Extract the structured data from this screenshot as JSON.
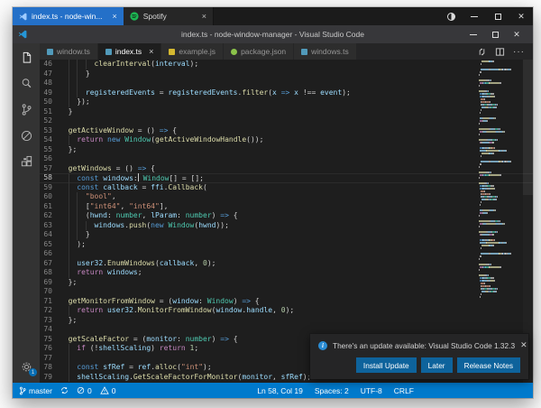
{
  "colors": {
    "accent_blue": "#007acc",
    "set_tab_active": "#2470c8",
    "btn_blue": "#0e639c",
    "ts_icon": "#519aba",
    "js_icon": "#d4b830",
    "json_icon": "#8bc34a",
    "spotify_green": "#1db954",
    "tok_kw": "#569cd6",
    "tok_ctrl": "#c586c0",
    "tok_fn": "#dcdcaa",
    "tok_type": "#4ec9b0",
    "tok_var": "#9cdcfe",
    "tok_str": "#ce9178",
    "tok_num": "#b5cea8",
    "tok_plain": "#d4d4d4"
  },
  "sets_bar": {
    "active_tab": {
      "label": "index.ts - node-win...",
      "close": "×"
    },
    "spotify_tab": {
      "label": "Spotify",
      "close": "×"
    }
  },
  "title_bar": {
    "title": "index.ts - node-window-manager - Visual Studio Code",
    "minimize": "",
    "maximize": "",
    "close": "✕"
  },
  "activity_bar": {
    "settings_badge": "1"
  },
  "editor": {
    "tabs": [
      {
        "label": "window.ts",
        "icon": "ts",
        "active": false
      },
      {
        "label": "index.ts",
        "icon": "ts",
        "active": true,
        "close": "×"
      },
      {
        "label": "example.js",
        "icon": "js",
        "active": false
      },
      {
        "label": "package.json",
        "icon": "json",
        "active": false
      },
      {
        "label": "windows.ts",
        "icon": "ts",
        "active": false
      }
    ],
    "actions": [
      "open-changes",
      "split-editor",
      "more-actions"
    ]
  },
  "code": {
    "lines": [
      {
        "n": 46,
        "s": [
          [
            "ws",
            "        "
          ],
          [
            "fn",
            "clearInterval"
          ],
          [
            "pl",
            "("
          ],
          [
            "vr",
            "interval"
          ],
          [
            "pl",
            ");"
          ]
        ]
      },
      {
        "n": 47,
        "s": [
          [
            "ws",
            "      "
          ],
          [
            "pl",
            "}"
          ]
        ]
      },
      {
        "n": 48,
        "s": []
      },
      {
        "n": 49,
        "s": [
          [
            "ws",
            "      "
          ],
          [
            "vr",
            "registeredEvents"
          ],
          [
            "pl",
            " = "
          ],
          [
            "vr",
            "registeredEvents"
          ],
          [
            "pl",
            "."
          ],
          [
            "fn",
            "filter"
          ],
          [
            "pl",
            "("
          ],
          [
            "vr",
            "x"
          ],
          [
            "pl",
            " "
          ],
          [
            "kw",
            "=>"
          ],
          [
            "pl",
            " "
          ],
          [
            "vr",
            "x"
          ],
          [
            "pl",
            " !== "
          ],
          [
            "vr",
            "event"
          ],
          [
            "pl",
            ");"
          ]
        ]
      },
      {
        "n": 50,
        "s": [
          [
            "ws",
            "    "
          ],
          [
            "pl",
            "});"
          ]
        ]
      },
      {
        "n": 51,
        "s": [
          [
            "ws",
            "  "
          ],
          [
            "pl",
            "}"
          ]
        ]
      },
      {
        "n": 52,
        "s": []
      },
      {
        "n": 53,
        "s": [
          [
            "ws",
            "  "
          ],
          [
            "fn",
            "getActiveWindow"
          ],
          [
            "pl",
            " = () "
          ],
          [
            "kw",
            "=>"
          ],
          [
            "pl",
            " {"
          ]
        ]
      },
      {
        "n": 54,
        "s": [
          [
            "ws",
            "    "
          ],
          [
            "ct",
            "return"
          ],
          [
            "pl",
            " "
          ],
          [
            "kw",
            "new"
          ],
          [
            "pl",
            " "
          ],
          [
            "ty",
            "Window"
          ],
          [
            "pl",
            "("
          ],
          [
            "fn",
            "getActiveWindowHandle"
          ],
          [
            "pl",
            "());"
          ]
        ]
      },
      {
        "n": 55,
        "s": [
          [
            "ws",
            "  "
          ],
          [
            "pl",
            "};"
          ]
        ]
      },
      {
        "n": 56,
        "s": []
      },
      {
        "n": 57,
        "s": [
          [
            "ws",
            "  "
          ],
          [
            "fn",
            "getWindows"
          ],
          [
            "pl",
            " = () "
          ],
          [
            "kw",
            "=>"
          ],
          [
            "pl",
            " {"
          ]
        ]
      },
      {
        "n": 58,
        "cur": true,
        "s": [
          [
            "ws",
            "    "
          ],
          [
            "kw",
            "const"
          ],
          [
            "pl",
            " "
          ],
          [
            "vr",
            "windows"
          ],
          [
            "pl",
            ":"
          ],
          [
            "cu",
            ""
          ],
          [
            "pl",
            " "
          ],
          [
            "ty",
            "Window"
          ],
          [
            "pl",
            "[] = [];"
          ]
        ]
      },
      {
        "n": 59,
        "s": [
          [
            "ws",
            "    "
          ],
          [
            "kw",
            "const"
          ],
          [
            "pl",
            " "
          ],
          [
            "vr",
            "callback"
          ],
          [
            "pl",
            " = "
          ],
          [
            "vr",
            "ffi"
          ],
          [
            "pl",
            "."
          ],
          [
            "fn",
            "Callback"
          ],
          [
            "pl",
            "("
          ]
        ]
      },
      {
        "n": 60,
        "s": [
          [
            "ws",
            "      "
          ],
          [
            "st",
            "\"bool\""
          ],
          [
            "pl",
            ","
          ]
        ]
      },
      {
        "n": 61,
        "s": [
          [
            "ws",
            "      "
          ],
          [
            "pl",
            "["
          ],
          [
            "st",
            "\"int64\""
          ],
          [
            "pl",
            ", "
          ],
          [
            "st",
            "\"int64\""
          ],
          [
            "pl",
            "],"
          ]
        ]
      },
      {
        "n": 62,
        "s": [
          [
            "ws",
            "      "
          ],
          [
            "pl",
            "("
          ],
          [
            "vr",
            "hwnd"
          ],
          [
            "pl",
            ": "
          ],
          [
            "ty",
            "number"
          ],
          [
            "pl",
            ", "
          ],
          [
            "vr",
            "lParam"
          ],
          [
            "pl",
            ": "
          ],
          [
            "ty",
            "number"
          ],
          [
            "pl",
            ") "
          ],
          [
            "kw",
            "=>"
          ],
          [
            "pl",
            " {"
          ]
        ]
      },
      {
        "n": 63,
        "s": [
          [
            "ws",
            "        "
          ],
          [
            "vr",
            "windows"
          ],
          [
            "pl",
            "."
          ],
          [
            "fn",
            "push"
          ],
          [
            "pl",
            "("
          ],
          [
            "kw",
            "new"
          ],
          [
            "pl",
            " "
          ],
          [
            "ty",
            "Window"
          ],
          [
            "pl",
            "("
          ],
          [
            "vr",
            "hwnd"
          ],
          [
            "pl",
            "));"
          ]
        ]
      },
      {
        "n": 64,
        "s": [
          [
            "ws",
            "      "
          ],
          [
            "pl",
            "}"
          ]
        ]
      },
      {
        "n": 65,
        "s": [
          [
            "ws",
            "    "
          ],
          [
            "pl",
            ");"
          ]
        ]
      },
      {
        "n": 66,
        "s": []
      },
      {
        "n": 67,
        "s": [
          [
            "ws",
            "    "
          ],
          [
            "vr",
            "user32"
          ],
          [
            "pl",
            "."
          ],
          [
            "fn",
            "EnumWindows"
          ],
          [
            "pl",
            "("
          ],
          [
            "vr",
            "callback"
          ],
          [
            "pl",
            ", "
          ],
          [
            "nm",
            "0"
          ],
          [
            "pl",
            ");"
          ]
        ]
      },
      {
        "n": 68,
        "s": [
          [
            "ws",
            "    "
          ],
          [
            "ct",
            "return"
          ],
          [
            "pl",
            " "
          ],
          [
            "vr",
            "windows"
          ],
          [
            "pl",
            ";"
          ]
        ]
      },
      {
        "n": 69,
        "s": [
          [
            "ws",
            "  "
          ],
          [
            "pl",
            "};"
          ]
        ]
      },
      {
        "n": 70,
        "s": []
      },
      {
        "n": 71,
        "s": [
          [
            "ws",
            "  "
          ],
          [
            "fn",
            "getMonitorFromWindow"
          ],
          [
            "pl",
            " = ("
          ],
          [
            "vr",
            "window"
          ],
          [
            "pl",
            ": "
          ],
          [
            "ty",
            "Window"
          ],
          [
            "pl",
            ") "
          ],
          [
            "kw",
            "=>"
          ],
          [
            "pl",
            " {"
          ]
        ]
      },
      {
        "n": 72,
        "s": [
          [
            "ws",
            "    "
          ],
          [
            "ct",
            "return"
          ],
          [
            "pl",
            " "
          ],
          [
            "vr",
            "user32"
          ],
          [
            "pl",
            "."
          ],
          [
            "fn",
            "MonitorFromWindow"
          ],
          [
            "pl",
            "("
          ],
          [
            "vr",
            "window"
          ],
          [
            "pl",
            "."
          ],
          [
            "vr",
            "handle"
          ],
          [
            "pl",
            ", "
          ],
          [
            "nm",
            "0"
          ],
          [
            "pl",
            ");"
          ]
        ]
      },
      {
        "n": 73,
        "s": [
          [
            "ws",
            "  "
          ],
          [
            "pl",
            "};"
          ]
        ]
      },
      {
        "n": 74,
        "s": []
      },
      {
        "n": 75,
        "s": [
          [
            "ws",
            "  "
          ],
          [
            "fn",
            "getScaleFactor"
          ],
          [
            "pl",
            " = ("
          ],
          [
            "vr",
            "monitor"
          ],
          [
            "pl",
            ": "
          ],
          [
            "ty",
            "number"
          ],
          [
            "pl",
            ") "
          ],
          [
            "kw",
            "=>"
          ],
          [
            "pl",
            " {"
          ]
        ]
      },
      {
        "n": 76,
        "s": [
          [
            "ws",
            "    "
          ],
          [
            "ct",
            "if"
          ],
          [
            "pl",
            " (!"
          ],
          [
            "vr",
            "shellScaling"
          ],
          [
            "pl",
            ") "
          ],
          [
            "ct",
            "return"
          ],
          [
            "pl",
            " "
          ],
          [
            "nm",
            "1"
          ],
          [
            "pl",
            ";"
          ]
        ]
      },
      {
        "n": 77,
        "s": []
      },
      {
        "n": 78,
        "s": [
          [
            "ws",
            "    "
          ],
          [
            "kw",
            "const"
          ],
          [
            "pl",
            " "
          ],
          [
            "vr",
            "sfRef"
          ],
          [
            "pl",
            " = "
          ],
          [
            "vr",
            "ref"
          ],
          [
            "pl",
            "."
          ],
          [
            "fn",
            "alloc"
          ],
          [
            "pl",
            "("
          ],
          [
            "st",
            "\"int\""
          ],
          [
            "pl",
            ");"
          ]
        ]
      },
      {
        "n": 79,
        "s": [
          [
            "ws",
            "    "
          ],
          [
            "vr",
            "shellScaling"
          ],
          [
            "pl",
            "."
          ],
          [
            "fn",
            "GetScaleFactorForMonitor"
          ],
          [
            "pl",
            "("
          ],
          [
            "vr",
            "monitor"
          ],
          [
            "pl",
            ", "
          ],
          [
            "vr",
            "sfRef"
          ],
          [
            "pl",
            ");"
          ]
        ]
      }
    ]
  },
  "notification": {
    "message": "There's an update available: Visual Studio Code 1.32.3",
    "buttons": [
      "Install Update",
      "Later",
      "Release Notes"
    ],
    "close": "✕"
  },
  "status_bar": {
    "branch": "master",
    "errors": "0",
    "warnings": "0",
    "right": [
      "Ln 58, Col 19",
      "Spaces: 2",
      "UTF-8",
      "CRLF"
    ]
  }
}
